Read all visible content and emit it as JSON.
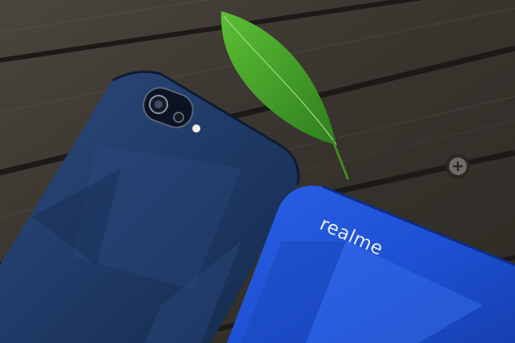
{
  "photo": {
    "brand_text": "realme",
    "colors": {
      "wood": "#3b3630",
      "phone_dark_blue": "#1e3a68",
      "phone_bright_blue": "#1c4fd0",
      "leaf": "#4aa62a"
    },
    "objects": [
      "wooden-table",
      "dark-blue-phone",
      "bright-blue-phone",
      "green-leaf",
      "camera-module",
      "flash",
      "screw"
    ]
  }
}
